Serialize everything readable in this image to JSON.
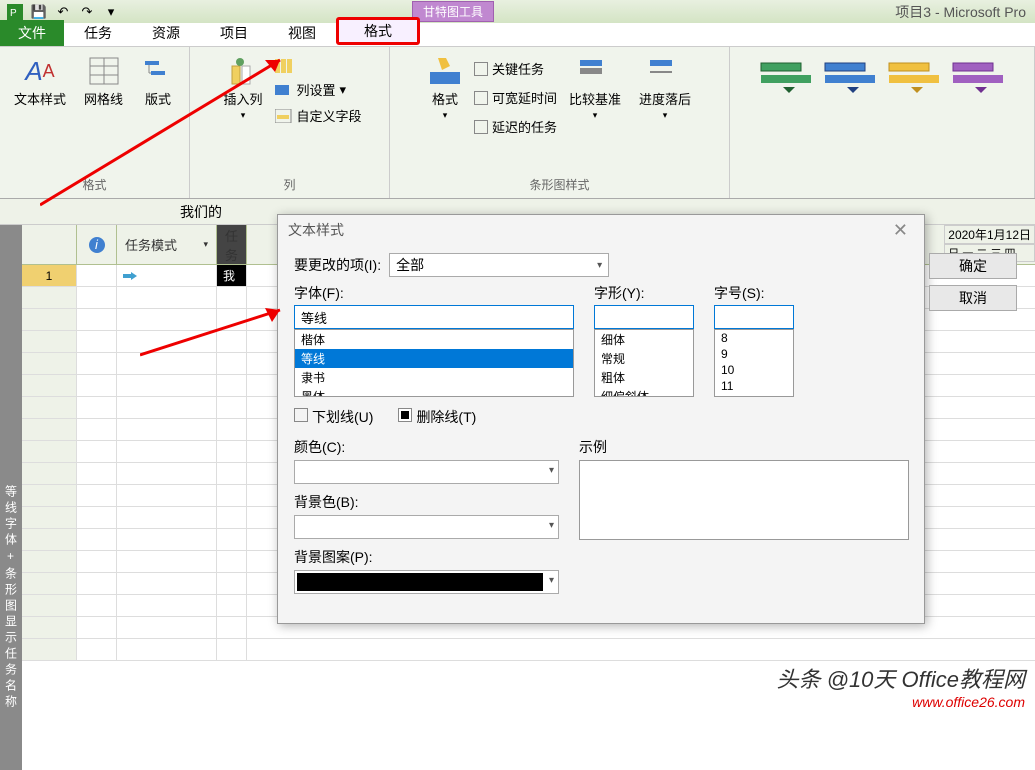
{
  "titlebar": {
    "tool_caption": "甘特图工具",
    "window_title": "项目3 - Microsoft Pro"
  },
  "tabs": {
    "file": "文件",
    "task": "任务",
    "resource": "资源",
    "project": "项目",
    "view": "视图",
    "format": "格式"
  },
  "ribbon": {
    "text_style": "文本样式",
    "gridlines": "网格线",
    "layout": "版式",
    "insert_col": "插入列",
    "col_settings": "列设置",
    "custom_fields": "自定义字段",
    "format_btn": "格式",
    "critical": "关键任务",
    "slack": "可宽延时间",
    "late": "延迟的任务",
    "baseline": "比较基准",
    "slippage": "进度落后",
    "group_format": "格式",
    "group_columns": "列",
    "group_barstyles": "条形图样式"
  },
  "project_row": "我们的",
  "columns": {
    "info": "i",
    "mode": "任务模式",
    "task": "任务"
  },
  "timeline": {
    "date1": "2020年1月12日",
    "days": "日 一 二 三 四"
  },
  "rows": {
    "r1_num": "1",
    "r1_task": "我"
  },
  "dialog": {
    "title": "文本样式",
    "item_label": "要更改的项(I):",
    "item_value": "全部",
    "font_label": "字体(F):",
    "style_label": "字形(Y):",
    "size_label": "字号(S):",
    "font_value": "等线",
    "style_value": "",
    "size_value": "",
    "ok": "确定",
    "cancel": "取消",
    "font_list": [
      "楷体",
      "等线",
      "隶书",
      "黑体"
    ],
    "style_list": [
      "细体",
      "常规",
      "粗体",
      "细偏斜体"
    ],
    "size_list": [
      "8",
      "9",
      "10",
      "11"
    ],
    "underline": "下划线(U)",
    "strike": "删除线(T)",
    "color_label": "颜色(C):",
    "sample_label": "示例",
    "bg_label": "背景色(B):",
    "pattern_label": "背景图案(P):"
  },
  "sidebar_text": "等线字体+条形图显示任务名称",
  "watermark": {
    "line1": "头条 @10天  Office教程网",
    "url": "www.office26.com"
  }
}
